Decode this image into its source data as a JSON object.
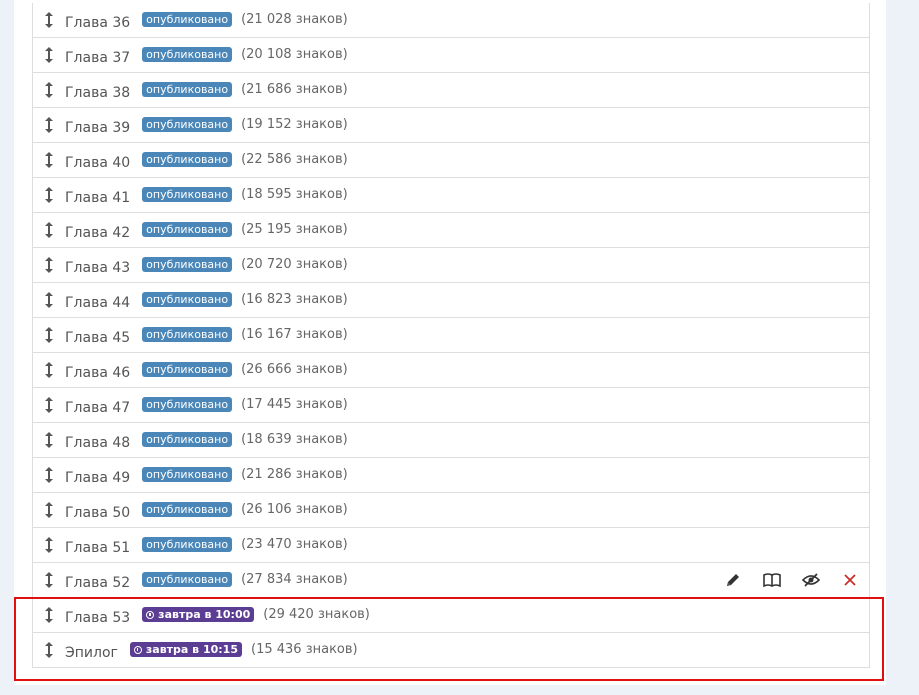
{
  "chapters": [
    {
      "title": "Глава 36",
      "status": "опубликовано",
      "chars": "(21 028 знаков)"
    },
    {
      "title": "Глава 37",
      "status": "опубликовано",
      "chars": "(20 108 знаков)"
    },
    {
      "title": "Глава 38",
      "status": "опубликовано",
      "chars": "(21 686 знаков)"
    },
    {
      "title": "Глава 39",
      "status": "опубликовано",
      "chars": "(19 152 знаков)"
    },
    {
      "title": "Глава 40",
      "status": "опубликовано",
      "chars": "(22 586 знаков)"
    },
    {
      "title": "Глава 41",
      "status": "опубликовано",
      "chars": "(18 595 знаков)"
    },
    {
      "title": "Глава 42",
      "status": "опубликовано",
      "chars": "(25 195 знаков)"
    },
    {
      "title": "Глава 43",
      "status": "опубликовано",
      "chars": "(20 720 знаков)"
    },
    {
      "title": "Глава 44",
      "status": "опубликовано",
      "chars": "(16 823 знаков)"
    },
    {
      "title": "Глава 45",
      "status": "опубликовано",
      "chars": "(16 167 знаков)"
    },
    {
      "title": "Глава 46",
      "status": "опубликовано",
      "chars": "(26 666 знаков)"
    },
    {
      "title": "Глава 47",
      "status": "опубликовано",
      "chars": "(17 445 знаков)"
    },
    {
      "title": "Глава 48",
      "status": "опубликовано",
      "chars": "(18 639 знаков)"
    },
    {
      "title": "Глава 49",
      "status": "опубликовано",
      "chars": "(21 286 знаков)"
    },
    {
      "title": "Глава 50",
      "status": "опубликовано",
      "chars": "(26 106 знаков)"
    },
    {
      "title": "Глава 51",
      "status": "опубликовано",
      "chars": "(23 470 знаков)"
    },
    {
      "title": "Глава 52",
      "status": "опубликовано",
      "chars": "(27 834 знаков)"
    },
    {
      "title": "Глава 53",
      "status": "завтра в 10:00",
      "chars": "(29 420 знаков)"
    },
    {
      "title": "Эпилог",
      "status": "завтра в 10:15",
      "chars": "(15 436 знаков)"
    }
  ],
  "badge_types": [
    "published",
    "published",
    "published",
    "published",
    "published",
    "published",
    "published",
    "published",
    "published",
    "published",
    "published",
    "published",
    "published",
    "published",
    "published",
    "published",
    "published",
    "scheduled",
    "scheduled"
  ],
  "hover_row_index": 16,
  "row_actions": [
    "pencil-icon",
    "book-icon",
    "eye-slash-icon",
    "close-icon"
  ],
  "colors": {
    "published_badge": "#4a86b7",
    "scheduled_badge": "#5c3d94",
    "highlight_border": "#e01010",
    "delete_icon": "#c9302c"
  }
}
